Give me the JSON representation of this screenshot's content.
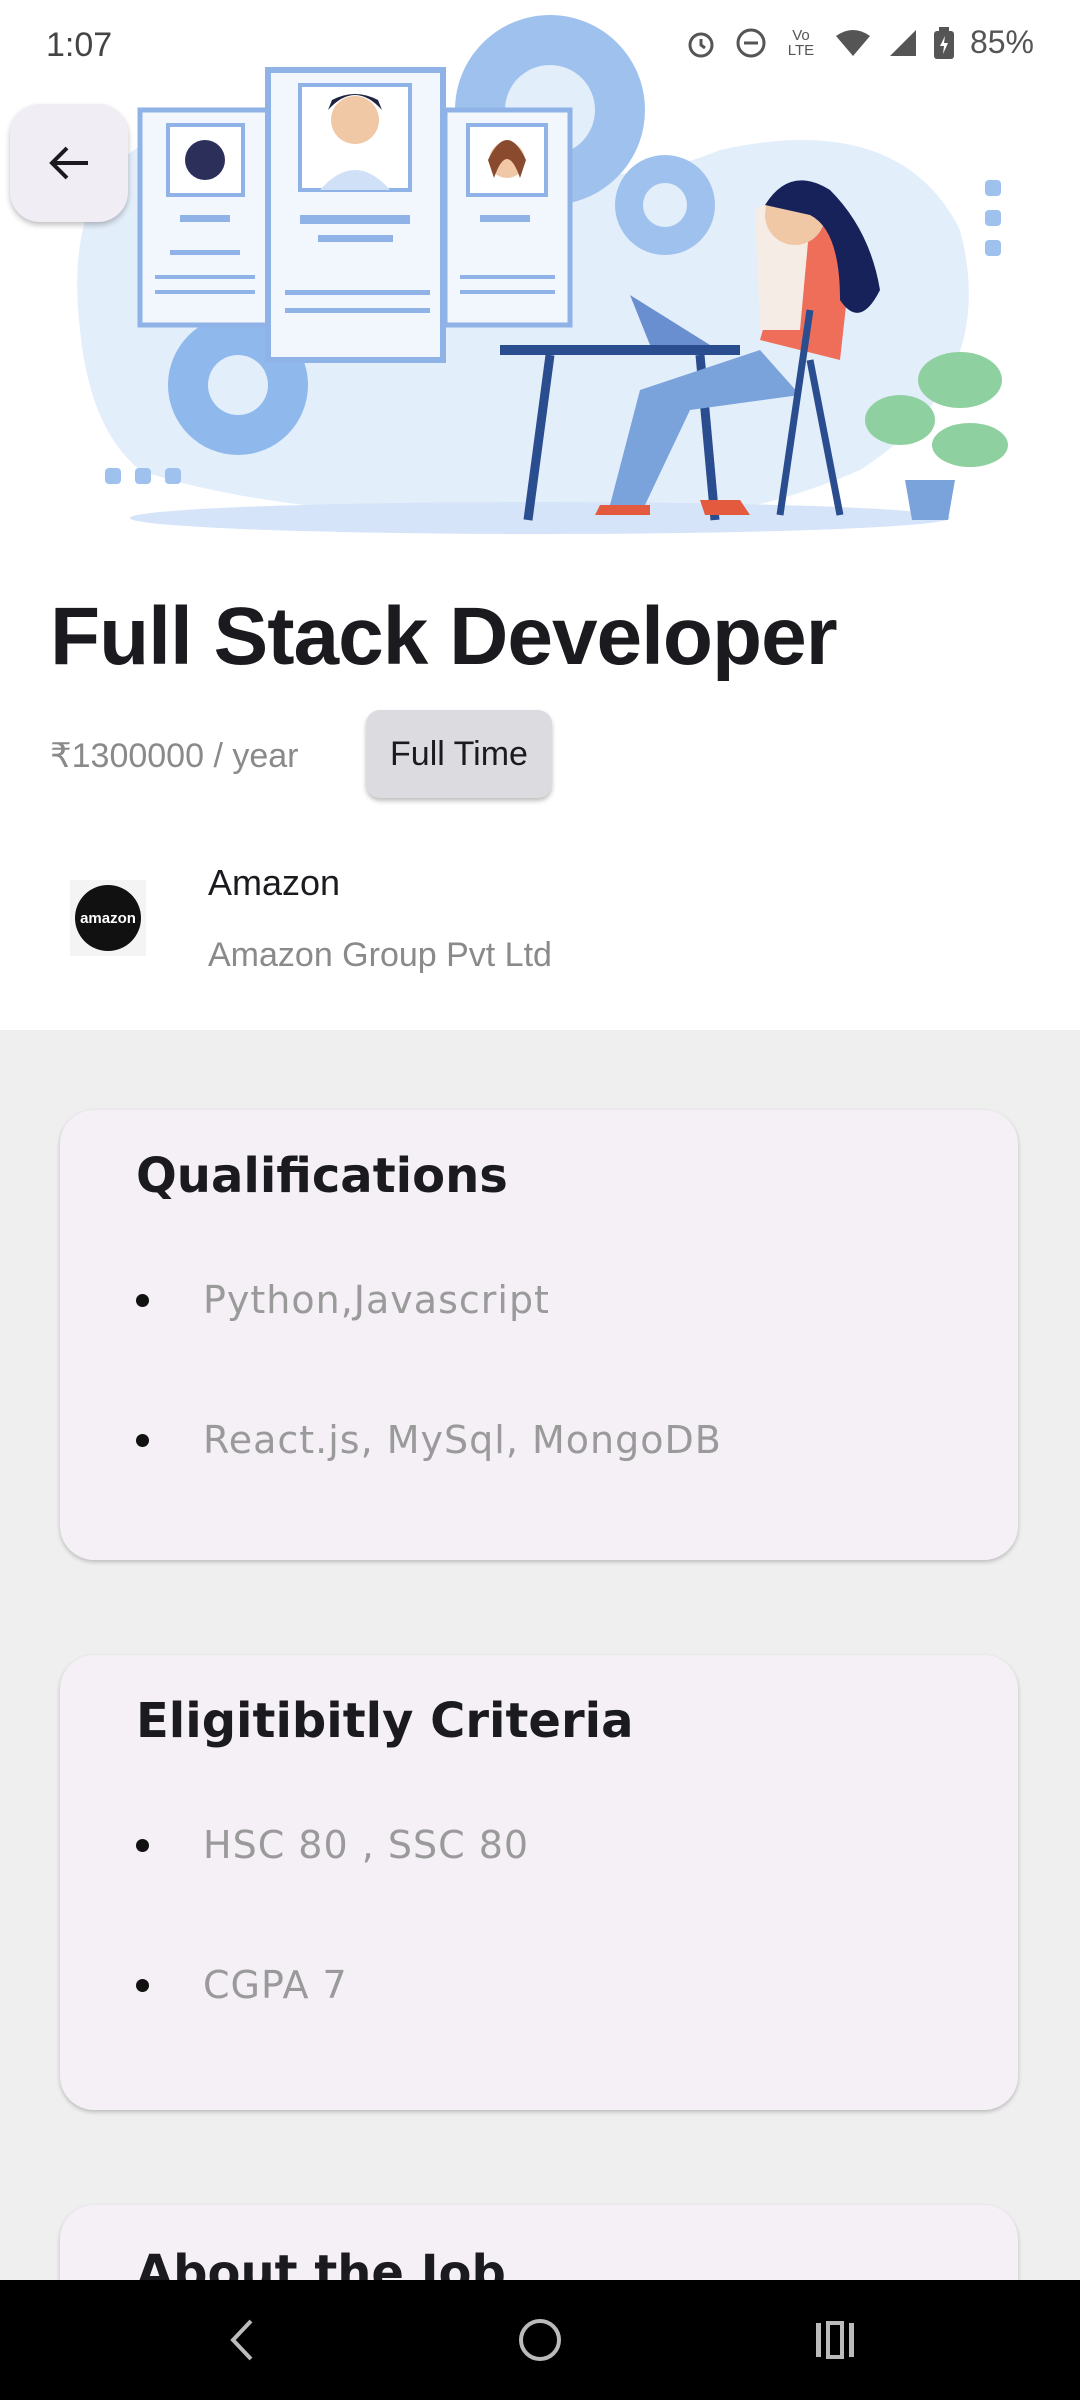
{
  "status_bar": {
    "time": "1:07",
    "battery": "85%",
    "volte_label": "Vo LTE"
  },
  "job": {
    "title": "Full Stack Developer",
    "salary": "₹1300000 / year",
    "type_chip": "Full Time"
  },
  "company": {
    "logo_text": "amazon",
    "name": "Amazon",
    "legal_name": "Amazon Group Pvt Ltd"
  },
  "sections": {
    "qualifications": {
      "title": "Qualifications",
      "items": [
        "Python,Javascript",
        "React.js, MySql, MongoDB"
      ]
    },
    "eligibility": {
      "title": "Eligitibitly Criteria",
      "items": [
        "HSC 80 , SSC 80",
        "CGPA 7"
      ]
    },
    "about": {
      "title": "About the Job"
    }
  },
  "colors": {
    "accent_blue": "#6a9ce0",
    "card_bg": "#f4f0f6",
    "content_bg": "#efefef",
    "chip_bg": "#dcdbe0"
  }
}
